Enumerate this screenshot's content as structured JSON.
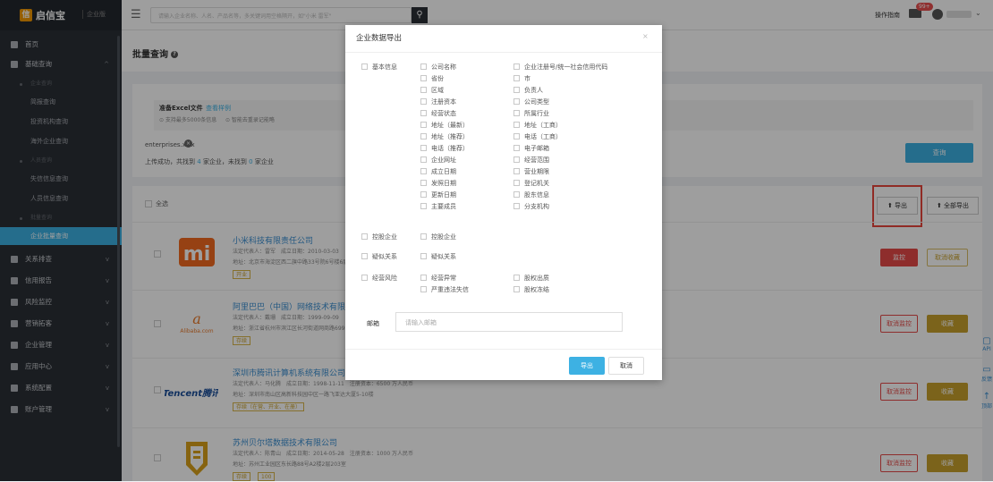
{
  "app": {
    "logo_mark": "信",
    "name": "启信宝",
    "edition": "企业版"
  },
  "topbar": {
    "search_placeholder": "请输入企业名称、人名、产品名等，多关键词用空格隔开，如\"小米 雷军\"",
    "guide": "操作指南",
    "mail_badge": "99+"
  },
  "sidebar": {
    "home": "首页",
    "basic_query": "基础查询",
    "group_company": "企业查询",
    "sub_announce": "简报查询",
    "sub_invest": "投资机构查询",
    "sub_overseas": "海外企业查询",
    "group_person": "人员查询",
    "sub_dishonest": "失信信息查询",
    "sub_person_info": "人员信息查询",
    "group_batch": "批量查询",
    "sub_batch": "企业批量查询",
    "relation": "关系排查",
    "credit_report": "信用报告",
    "risk_monitor": "风险监控",
    "marketing": "营销拓客",
    "enterprise_mgmt": "企业管理",
    "app_center": "应用中心",
    "sys_config": "系统配置",
    "account_mgmt": "账户管理"
  },
  "page": {
    "title": "批量查询",
    "help": "?"
  },
  "prepare": {
    "title": "准备Excel文件",
    "sample_link": "查看样例",
    "limit": "⊙ 支持最多5000条信息",
    "dedupe": "⊙ 智能去重录记能略"
  },
  "upload": {
    "filename": "enterprises.xlsx",
    "result_prefix": "上传成功，共找到",
    "found": "4",
    "mid": "家企业，未找到",
    "missing": "0",
    "suffix": "家企业"
  },
  "buttons": {
    "query": "查询",
    "select_all": "全选",
    "export": "导出",
    "export_all": "全部导出"
  },
  "companies": [
    {
      "name": "小米科技有限责任公司",
      "meta1": "法定代表人：雷军　成立日期：2010-03-03",
      "meta2": "地址：北京市海淀区西二旗中路33号院6号楼6层006号",
      "tags": [
        "开业"
      ],
      "btn1": "监控",
      "btn2": "取消收藏"
    },
    {
      "name": "阿里巴巴（中国）网络技术有限公司",
      "meta1": "法定代表人：戴珊　成立日期：1999-09-09",
      "meta2": "地址：浙江省杭州市滨江区长河街道网商路699号",
      "tags": [
        "存续"
      ],
      "btn1": "取消监控",
      "btn2": "收藏"
    },
    {
      "name": "深圳市腾讯计算机系统有限公司",
      "meta1": "法定代表人：马化腾　成立日期：1998-11-11　注册资本：6500 万人民币",
      "meta2": "地址：深圳市南山区高新科技园中区一路飞亚达大厦5-10楼",
      "tags": [
        "存续（在营、开业、在册）"
      ],
      "btn1": "取消监控",
      "btn2": "收藏"
    },
    {
      "name": "苏州贝尔塔数据技术有限公司",
      "meta1": "法定代表人：陈青山　成立日期：2014-05-28　注册资本：1000 万人民币",
      "meta2": "地址：苏州工业园区东长路88号A2楼2层203室",
      "tags": [
        "存续",
        "100"
      ],
      "btn1": "取消监控",
      "btn2": "收藏"
    }
  ],
  "float_side": {
    "api": "API",
    "feedback": "反馈",
    "top": "顶部"
  },
  "modal": {
    "title": "企业数据导出",
    "close": "×",
    "groups": {
      "basic": "基本信息",
      "holding": "控股企业",
      "suspect": "疑似关系",
      "risk": "经营风险"
    },
    "basic_col1": [
      "公司名称",
      "省份",
      "区域",
      "注册资本",
      "经营状态",
      "地址（最新）",
      "地址（推荐）",
      "电话（推荐）",
      "企业网址",
      "成立日期",
      "发照日期",
      "更新日期",
      "主要成员"
    ],
    "basic_col2": [
      "企业注册号/统一社会信用代码",
      "市",
      "负责人",
      "公司类型",
      "所属行业",
      "地址（工商）",
      "电话（工商）",
      "电子邮箱",
      "经营范围",
      "营业期限",
      "登记机关",
      "股东信息",
      "分支机构"
    ],
    "holding_item": "控股企业",
    "suspect_item": "疑似关系",
    "risk_col1": [
      "经营异常",
      "严重违法失信"
    ],
    "risk_col2": [
      "股权出质",
      "股权冻结"
    ],
    "email_label": "邮箱",
    "email_placeholder": "请输入邮箱",
    "ok": "导出",
    "cancel": "取消"
  },
  "colors": {
    "accent": "#3db1e3",
    "sidebar_bg": "#2b2f36",
    "danger": "#e64a47",
    "gold": "#c7a02c",
    "highlight_box": "#e8463c"
  }
}
